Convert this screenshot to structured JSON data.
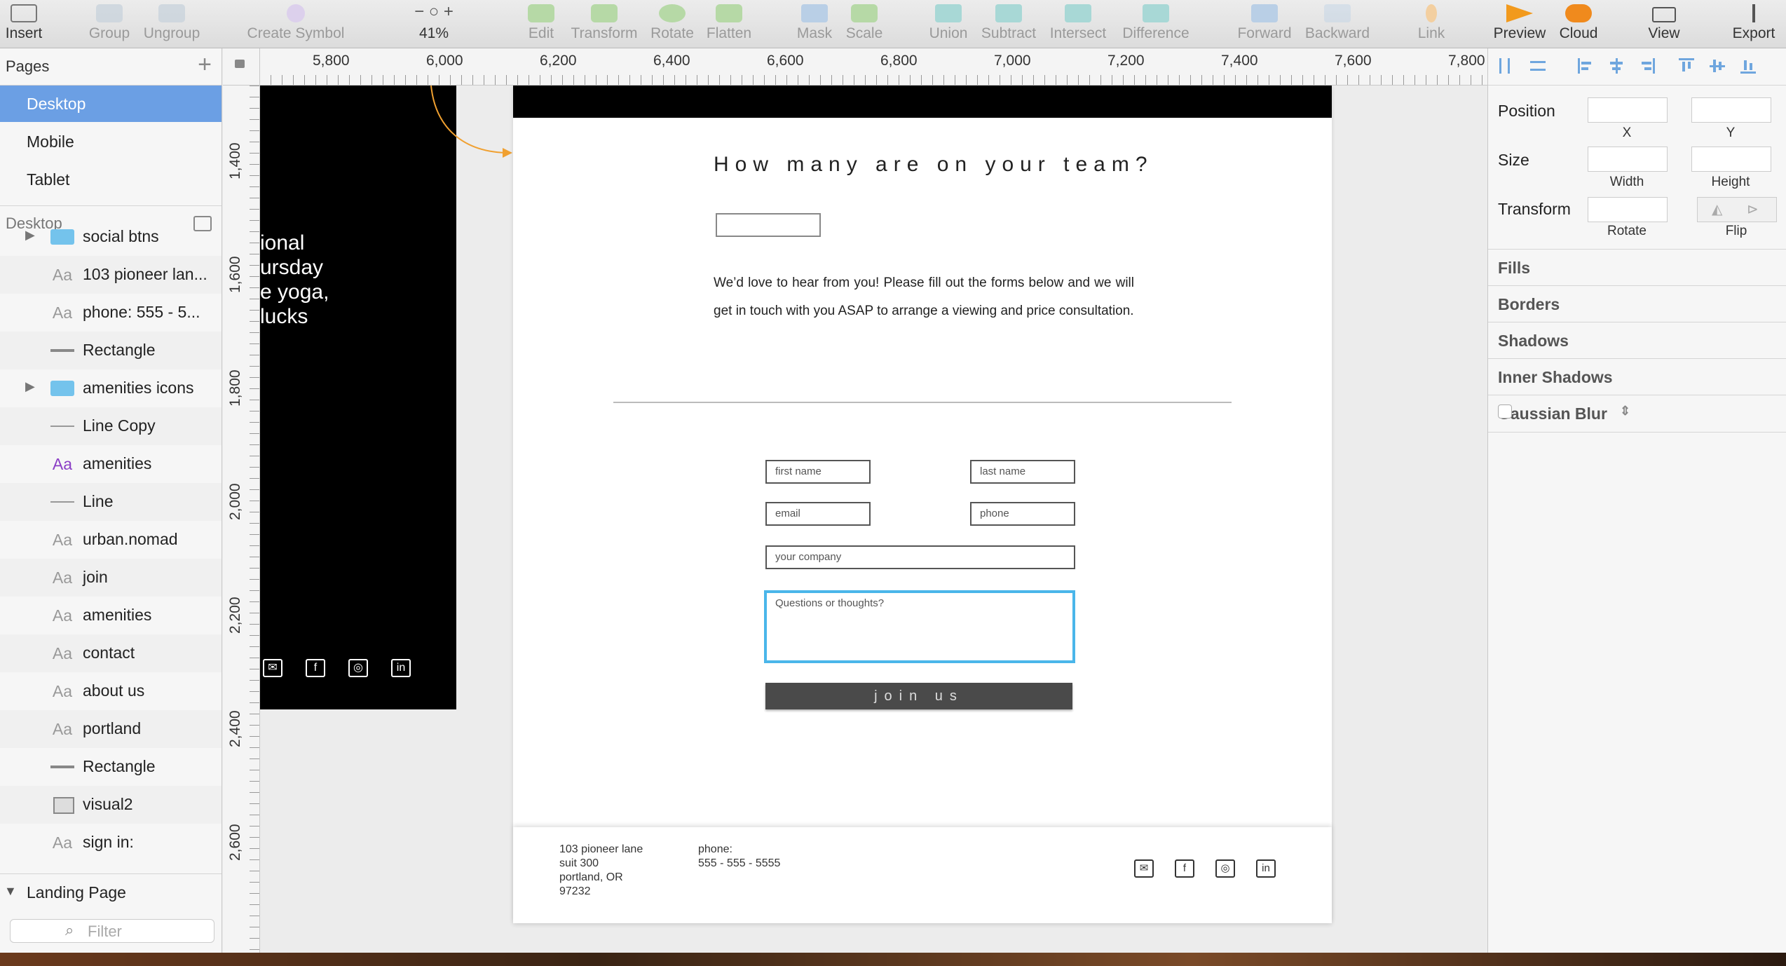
{
  "toolbar": {
    "items": [
      {
        "label": "Insert",
        "dim": false
      },
      {
        "label": "Group",
        "dim": true
      },
      {
        "label": "Ungroup",
        "dim": true
      },
      {
        "label": "Create Symbol",
        "dim": true
      },
      {
        "label": "41%",
        "dim": false
      },
      {
        "label": "Edit",
        "dim": true
      },
      {
        "label": "Transform",
        "dim": true
      },
      {
        "label": "Rotate",
        "dim": true
      },
      {
        "label": "Flatten",
        "dim": true
      },
      {
        "label": "Mask",
        "dim": true
      },
      {
        "label": "Scale",
        "dim": true
      },
      {
        "label": "Union",
        "dim": true
      },
      {
        "label": "Subtract",
        "dim": true
      },
      {
        "label": "Intersect",
        "dim": true
      },
      {
        "label": "Difference",
        "dim": true
      },
      {
        "label": "Forward",
        "dim": true
      },
      {
        "label": "Backward",
        "dim": true
      },
      {
        "label": "Link",
        "dim": true
      },
      {
        "label": "Preview",
        "dim": false
      },
      {
        "label": "Cloud",
        "dim": false
      },
      {
        "label": "View",
        "dim": false
      },
      {
        "label": "Export",
        "dim": false
      }
    ]
  },
  "pages": {
    "title": "Pages",
    "items": [
      "Desktop",
      "Mobile",
      "Tablet"
    ],
    "selected": "Desktop"
  },
  "layers": {
    "title": "Desktop",
    "items": [
      {
        "name": "social btns",
        "icon": "folder-icon"
      },
      {
        "name": "103 pioneer lan...",
        "icon": "text-icon"
      },
      {
        "name": "phone: 555 - 5...",
        "icon": "text-icon"
      },
      {
        "name": "Rectangle",
        "icon": "rectangle-icon"
      },
      {
        "name": "amenities icons",
        "icon": "folder-icon"
      },
      {
        "name": "Line Copy",
        "icon": "line-icon"
      },
      {
        "name": "amenities",
        "icon": "text-icon-purple"
      },
      {
        "name": "Line",
        "icon": "line-icon"
      },
      {
        "name": "urban.nomad",
        "icon": "text-link-icon"
      },
      {
        "name": "join",
        "icon": "text-link-icon"
      },
      {
        "name": "amenities",
        "icon": "text-icon"
      },
      {
        "name": "contact",
        "icon": "text-link-icon"
      },
      {
        "name": "about us",
        "icon": "text-link-icon"
      },
      {
        "name": "portland",
        "icon": "text-icon"
      },
      {
        "name": "Rectangle",
        "icon": "rectangle-icon"
      },
      {
        "name": "visual2",
        "icon": "image-icon"
      },
      {
        "name": "sign in:",
        "icon": "text-icon"
      }
    ],
    "landing": "Landing Page",
    "filter_placeholder": "Filter"
  },
  "ruler": {
    "top": [
      "5,800",
      "6,000",
      "6,200",
      "6,400",
      "6,600",
      "6,800",
      "7,000",
      "7,200",
      "7,400",
      "7,600",
      "7,800"
    ],
    "left": [
      "1,400",
      "1,600",
      "1,800",
      "2,000",
      "2,200",
      "2,400",
      "2,600"
    ]
  },
  "dark_artboard": {
    "lines": [
      "ional",
      "ursday",
      "e yoga,",
      "lucks"
    ],
    "icons": [
      "mail-icon",
      "facebook-icon",
      "instagram-icon",
      "linkedin-icon"
    ]
  },
  "artboard": {
    "question": "How many are on your team?",
    "paragraph": "We’d love to hear from you! Please fill out the forms below and we will get in touch with you ASAP to arrange a viewing and price consultation.",
    "fields": {
      "first_name": "first name",
      "last_name": "last name",
      "email": "email",
      "phone": "phone",
      "company": "your company",
      "thoughts": "Questions or thoughts?"
    },
    "button": "join us",
    "footer": {
      "address": [
        "103 pioneer lane",
        "suit 300",
        "portland, OR",
        "97232"
      ],
      "phone_label": "phone:",
      "phone": "555 - 555 - 5555",
      "icons": [
        "mail-icon",
        "facebook-icon",
        "instagram-icon",
        "linkedin-icon"
      ]
    },
    "colors": {
      "focus": "#4ab6ea",
      "button": "#4a4a4a"
    }
  },
  "inspector": {
    "position": "Position",
    "x": "X",
    "y": "Y",
    "size": "Size",
    "width": "Width",
    "height": "Height",
    "transform": "Transform",
    "rotate": "Rotate",
    "flip": "Flip",
    "sections": [
      "Fills",
      "Borders",
      "Shadows",
      "Inner Shadows",
      "Gaussian Blur"
    ]
  }
}
